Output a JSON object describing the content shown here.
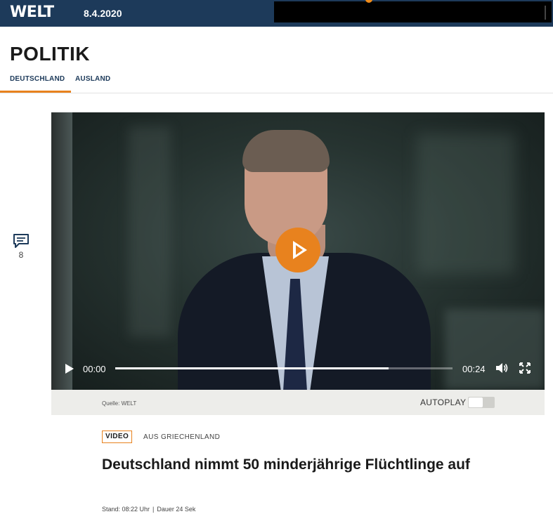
{
  "header": {
    "logo": "WELT",
    "date": "8.4.2020"
  },
  "section": {
    "title": "POLITIK",
    "nav": [
      {
        "label": "DEUTSCHLAND",
        "active": true
      },
      {
        "label": "AUSLAND",
        "active": false
      }
    ]
  },
  "comments": {
    "icon": "comment-icon",
    "count": "8"
  },
  "video": {
    "current_time": "00:00",
    "total_time": "00:24",
    "progress_buffered": 0.81,
    "source": "Quelle: WELT",
    "autoplay_label": "AUTOPLAY",
    "autoplay_on": false
  },
  "article": {
    "badge": "VIDEO",
    "kicker": "AUS GRIECHENLAND",
    "headline": "Deutschland nimmt 50 minderjährige Flüchtlinge auf",
    "stand": "Stand: 08:22 Uhr",
    "separator": "|",
    "duration": "Dauer 24 Sek"
  },
  "colors": {
    "brand_navy": "#1d3a5a",
    "accent_orange": "#e8821e"
  }
}
